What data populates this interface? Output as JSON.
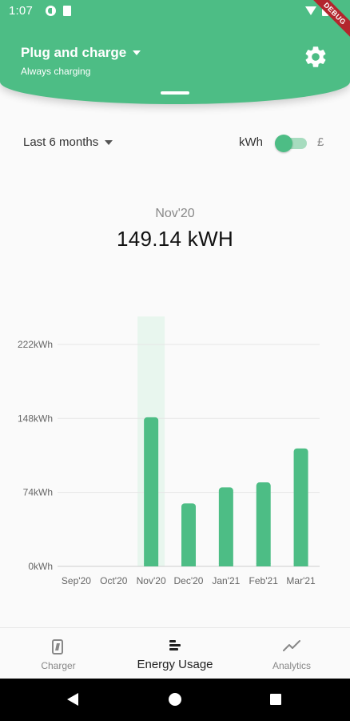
{
  "status_bar": {
    "time": "1:07",
    "debug_banner": "DEBUG"
  },
  "header": {
    "title": "Plug and charge",
    "subtitle": "Always charging"
  },
  "controls": {
    "period": "Last 6 months",
    "unit_left": "kWh",
    "unit_right": "£",
    "toggle_on_left": true
  },
  "selection": {
    "month": "Nov'20",
    "value": "149.14 kWH"
  },
  "colors": {
    "accent": "#4dbd85",
    "highlight": "#e8f6ee",
    "grid": "#e6e6e6"
  },
  "chart_data": {
    "type": "bar",
    "categories": [
      "Sep'20",
      "Oct'20",
      "Nov'20",
      "Dec'20",
      "Jan'21",
      "Feb'21",
      "Mar'21"
    ],
    "values": [
      0,
      0,
      149.14,
      63,
      79,
      84,
      118
    ],
    "y_ticks": [
      "0kWh",
      "74kWh",
      "148kWh",
      "222kWh"
    ],
    "y_tick_values": [
      0,
      74,
      148,
      222
    ],
    "ylim": [
      0,
      250
    ],
    "highlighted_category": "Nov'20",
    "grid": true
  },
  "bottom_nav": {
    "items": [
      {
        "label": "Charger",
        "icon": "charger-icon",
        "active": false
      },
      {
        "label": "Energy Usage",
        "icon": "energy-usage-icon",
        "active": true
      },
      {
        "label": "Analytics",
        "icon": "analytics-icon",
        "active": false
      }
    ]
  }
}
